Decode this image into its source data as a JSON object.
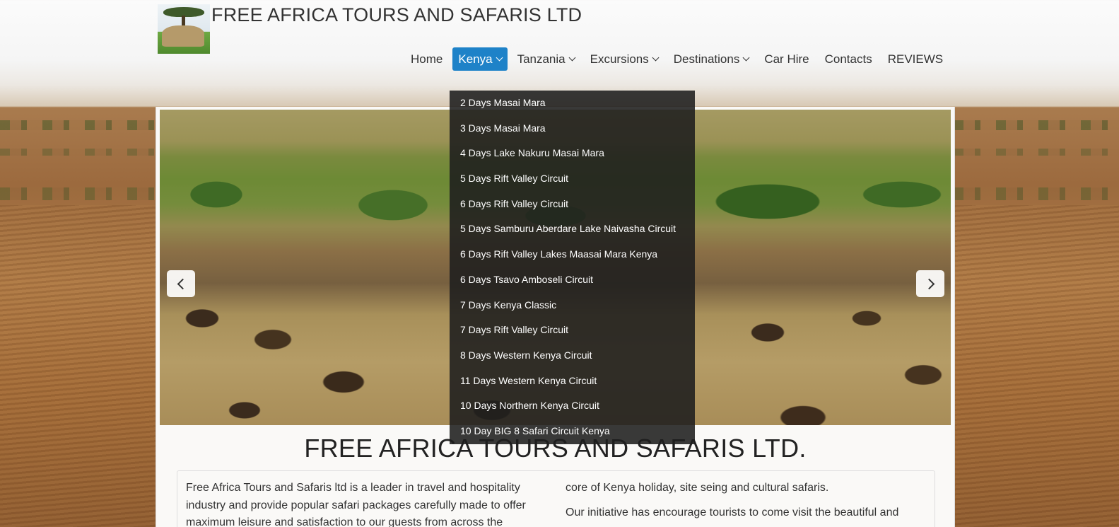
{
  "site": {
    "title": "FREE AFRICA TOURS AND SAFARIS LTD"
  },
  "nav": {
    "items": [
      {
        "label": "Home",
        "has_dropdown": false,
        "active": false
      },
      {
        "label": "Kenya",
        "has_dropdown": true,
        "active": true
      },
      {
        "label": "Tanzania",
        "has_dropdown": true,
        "active": false
      },
      {
        "label": "Excursions",
        "has_dropdown": true,
        "active": false
      },
      {
        "label": "Destinations",
        "has_dropdown": true,
        "active": false
      },
      {
        "label": "Car Hire",
        "has_dropdown": false,
        "active": false
      },
      {
        "label": "Contacts",
        "has_dropdown": false,
        "active": false
      },
      {
        "label": "REVIEWS",
        "has_dropdown": false,
        "active": false
      }
    ],
    "active_color": "#1e82c8"
  },
  "kenya_menu": {
    "items": [
      "2 Days Masai Mara",
      "3 Days Masai Mara",
      "4 Days Lake Nakuru Masai Mara",
      "5 Days Rift Valley Circuit",
      "6 Days Rift Valley Circuit",
      "5 Days Samburu Aberdare Lake Naivasha Circuit",
      "6 Days Rift Valley Lakes Maasai Mara Kenya",
      "6 Days Tsavo Amboseli Circuit",
      "7 Days Kenya Classic",
      "7 Days Rift Valley Circuit",
      "8 Days Western Kenya Circuit",
      "11 Days Western Kenya Circuit",
      "10 Days Northern Kenya Circuit",
      "10 Day BIG 8 Safari Circuit Kenya"
    ]
  },
  "slider": {
    "prev_icon": "chevron-left-icon",
    "next_icon": "chevron-right-icon"
  },
  "main": {
    "heading": "FREE AFRICA TOURS AND SAFARIS LTD.",
    "intro_left": "Free Africa Tours and Safaris ltd is a leader in travel and hospitality industry and provide popular safari packages carefully made to offer maximum leisure and satisfaction to our guests from across the",
    "intro_right_1": "core of Kenya holiday, site seing and cultural safaris.",
    "intro_right_2": "Our initiative has encourage tourists to come visit the beautiful and"
  }
}
